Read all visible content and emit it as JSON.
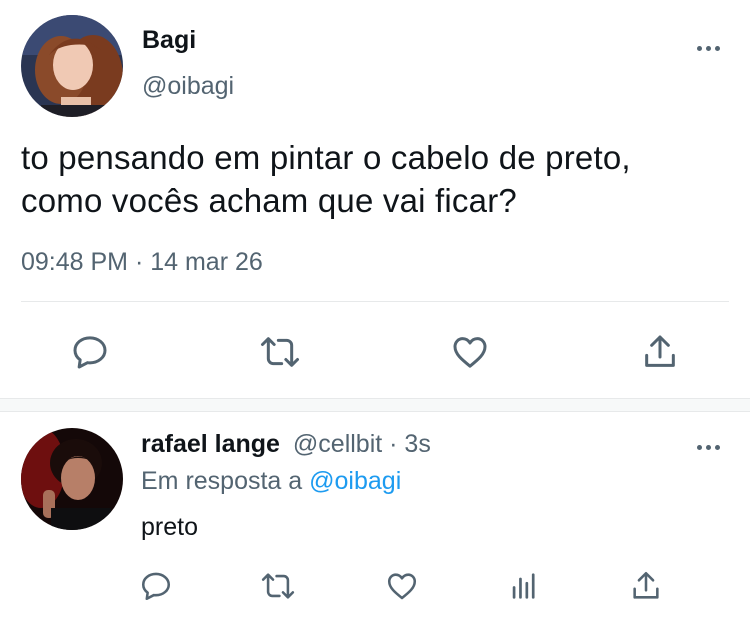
{
  "main_tweet": {
    "author_name": "Bagi",
    "author_handle": "@oibagi",
    "avatar_icon": "profile-photo-bagi",
    "text_line1": "to pensando em pintar o cabelo de preto,",
    "text_line2": "como vocês acham que vai ficar?",
    "timestamp": "09:48 PM · 14 mar 26",
    "more_icon": "more-dots-icon",
    "actions": [
      "reply-icon",
      "retweet-icon",
      "like-icon",
      "share-icon"
    ]
  },
  "reply_tweet": {
    "author_name": "rafael lange",
    "author_handle": "@cellbit",
    "time_ago": "· 3s",
    "reply_prefix": "Em resposta a",
    "reply_to": "@oibagi",
    "text": "preto",
    "avatar_icon": "profile-photo-rafael",
    "actions": [
      "reply-icon",
      "retweet-icon",
      "like-icon",
      "analytics-icon",
      "share-icon"
    ]
  },
  "colors": {
    "text": "#0f1419",
    "muted": "#536471",
    "link": "#1d9bf0",
    "divider": "#e7e9ea",
    "section_gap": "#f7f9f9"
  }
}
